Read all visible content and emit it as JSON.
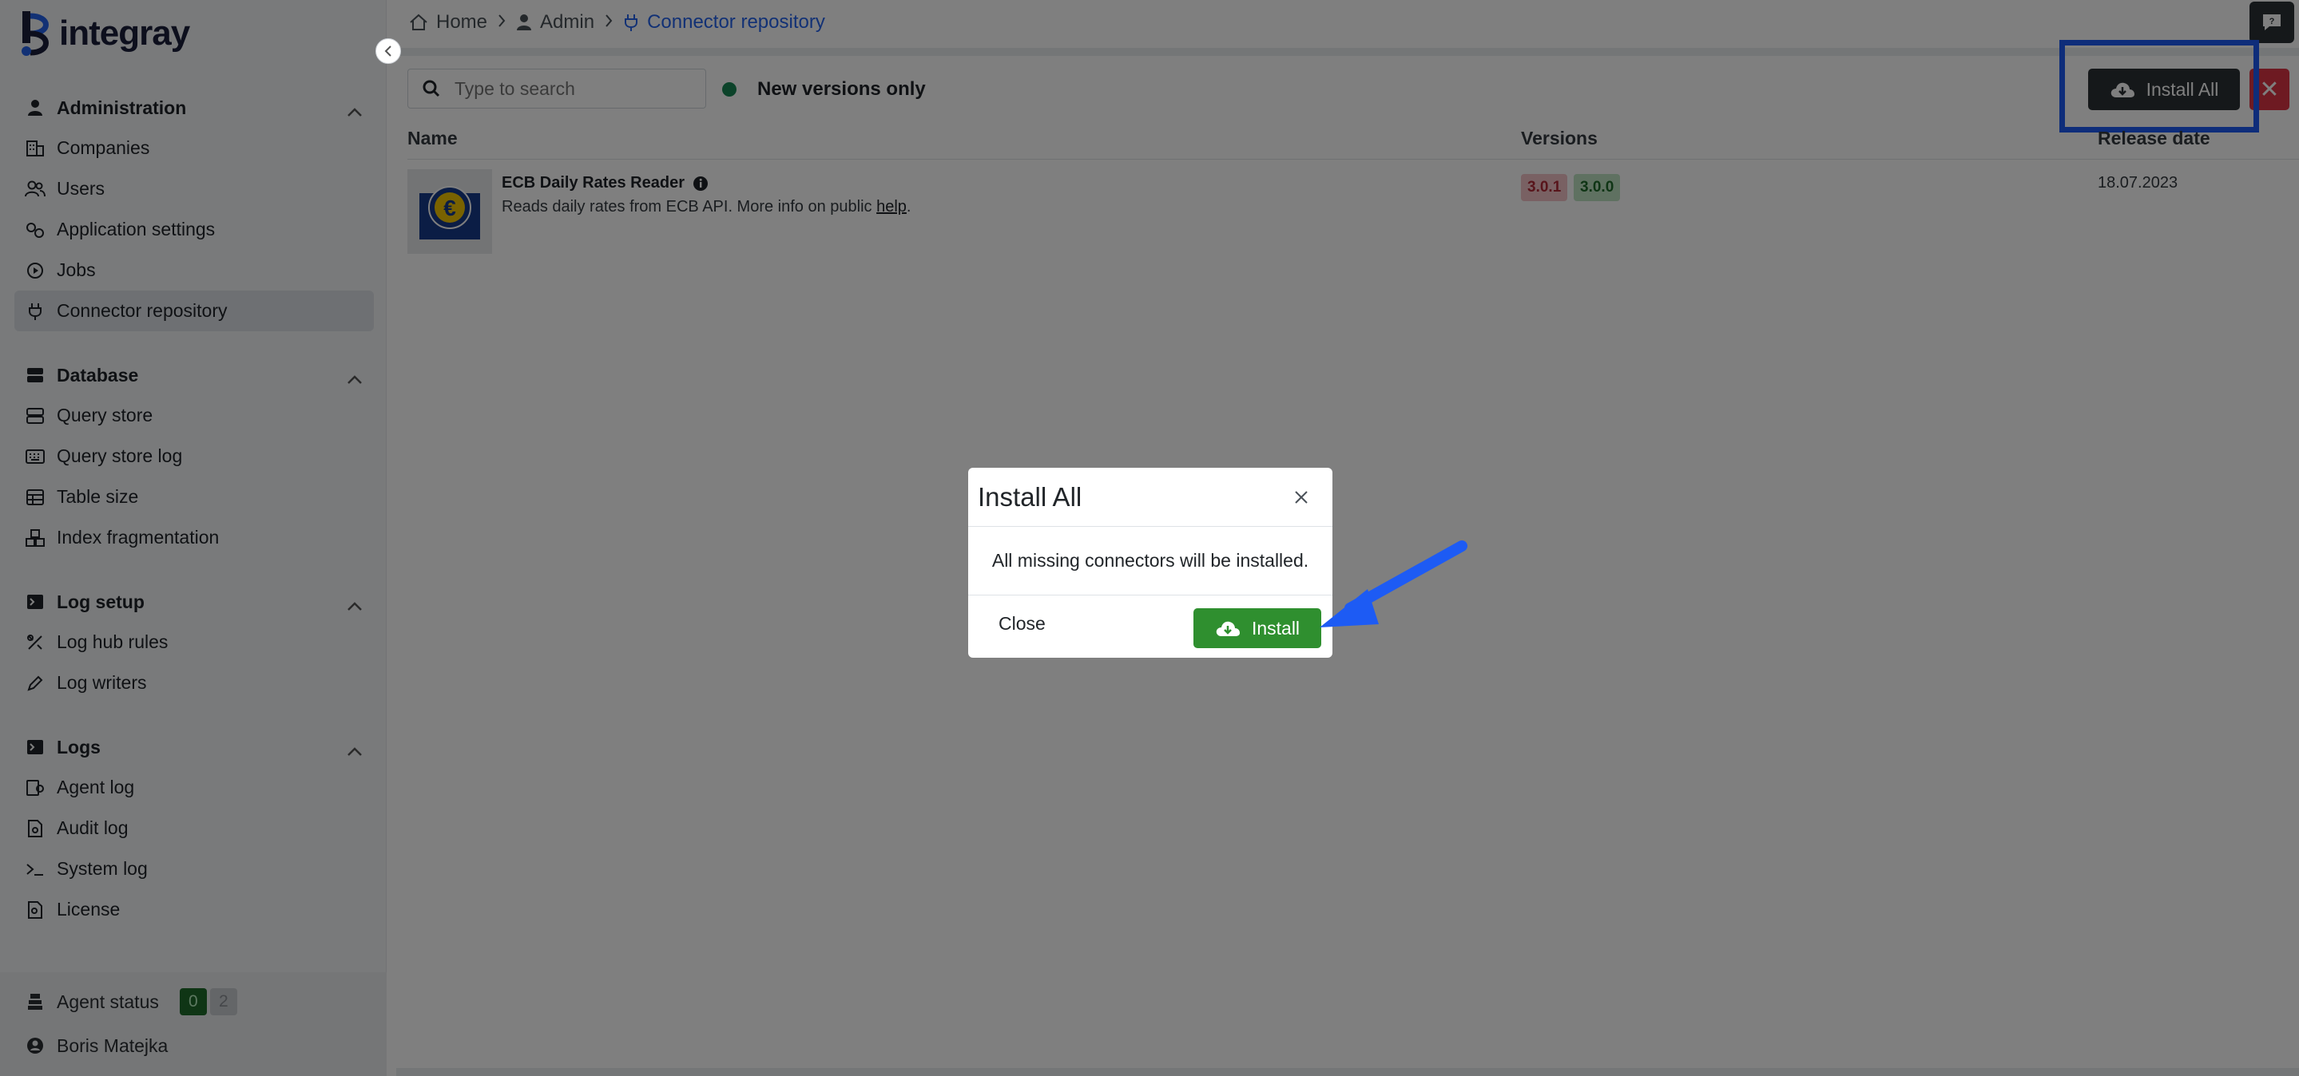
{
  "app": {
    "name": "integray"
  },
  "sidebar": {
    "sections": [
      {
        "title": "Administration",
        "items": [
          {
            "label": "Companies",
            "icon": "companies-icon"
          },
          {
            "label": "Users",
            "icon": "users-icon"
          },
          {
            "label": "Application settings",
            "icon": "settings-icon"
          },
          {
            "label": "Jobs",
            "icon": "jobs-icon"
          },
          {
            "label": "Connector repository",
            "icon": "plug-icon",
            "active": true
          }
        ]
      },
      {
        "title": "Database",
        "items": [
          {
            "label": "Query store",
            "icon": "query-store-icon"
          },
          {
            "label": "Query store log",
            "icon": "keyboard-icon"
          },
          {
            "label": "Table size",
            "icon": "table-icon"
          },
          {
            "label": "Index fragmentation",
            "icon": "boxes-icon"
          }
        ]
      },
      {
        "title": "Log setup",
        "items": [
          {
            "label": "Log hub rules",
            "icon": "rules-icon"
          },
          {
            "label": "Log writers",
            "icon": "pencil-icon"
          }
        ]
      },
      {
        "title": "Logs",
        "items": [
          {
            "label": "Agent log",
            "icon": "agent-log-icon"
          },
          {
            "label": "Audit log",
            "icon": "audit-log-icon"
          },
          {
            "label": "System log",
            "icon": "terminal-icon"
          },
          {
            "label": "License",
            "icon": "license-icon"
          }
        ]
      }
    ],
    "footer": {
      "agent_status_label": "Agent status",
      "agent_ok": "0",
      "agent_total": "2",
      "user_name": "Boris Matejka"
    }
  },
  "breadcrumb": {
    "home": "Home",
    "admin": "Admin",
    "current": "Connector repository"
  },
  "toolbar": {
    "search_placeholder": "Type to search",
    "toggle_label": "New versions only",
    "install_all_label": "Install All",
    "close_label": "✕"
  },
  "table": {
    "headers": {
      "name": "Name",
      "versions": "Versions",
      "release_date": "Release date"
    },
    "rows": [
      {
        "name": "ECB Daily Rates Reader",
        "description_prefix": "Reads daily rates from ECB API. More info on public ",
        "description_link": "help",
        "description_suffix": ".",
        "installed_version": "3.0.1",
        "new_version": "3.0.0",
        "release_date": "18.07.2023"
      }
    ]
  },
  "modal": {
    "title": "Install All",
    "body": "All missing connectors will be installed.",
    "close_label": "Close",
    "install_label": "Install"
  },
  "colors": {
    "accent": "#2563eb",
    "install_green": "#2f8f2f",
    "danger": "#dc3545",
    "highlight": "#1d5bf4"
  }
}
